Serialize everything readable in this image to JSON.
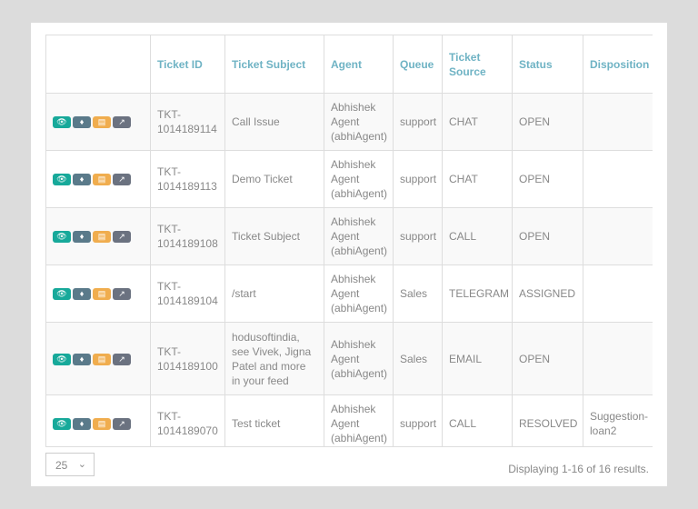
{
  "table": {
    "headers": [
      "",
      "Ticket ID",
      "Ticket Subject",
      "Agent",
      "Queue",
      "Ticket Source",
      "Status",
      "Disposition"
    ],
    "actions": [
      "view-icon",
      "ticket-icon",
      "list-icon",
      "share-icon"
    ],
    "rows": [
      {
        "id": "TKT-1014189114",
        "subject": "Call Issue",
        "agent": "Abhishek Agent (abhiAgent)",
        "queue": "support",
        "source": "CHAT",
        "status": "OPEN",
        "disposition": ""
      },
      {
        "id": "TKT-1014189113",
        "subject": "Demo Ticket",
        "agent": "Abhishek Agent (abhiAgent)",
        "queue": "support",
        "source": "CHAT",
        "status": "OPEN",
        "disposition": ""
      },
      {
        "id": "TKT-1014189108",
        "subject": "Ticket Subject",
        "agent": "Abhishek Agent (abhiAgent)",
        "queue": "support",
        "source": "CALL",
        "status": "OPEN",
        "disposition": ""
      },
      {
        "id": "TKT-1014189104",
        "subject": "/start",
        "agent": "Abhishek Agent (abhiAgent)",
        "queue": "Sales",
        "source": "TELEGRAM",
        "status": "ASSIGNED",
        "disposition": ""
      },
      {
        "id": "TKT-1014189100",
        "subject": "hodusoftindia, see Vivek, Jigna Patel and more in your feed",
        "agent": "Abhishek Agent (abhiAgent)",
        "queue": "Sales",
        "source": "EMAIL",
        "status": "OPEN",
        "disposition": ""
      },
      {
        "id": "TKT-1014189070",
        "subject": "Test ticket",
        "agent": "Abhishek Agent (abhiAgent)",
        "queue": "support",
        "source": "CALL",
        "status": "RESOLVED",
        "disposition": "Suggestion-loan2"
      }
    ]
  },
  "pagination": {
    "page_size": "25",
    "summary": "Displaying 1-16 of 16 results."
  }
}
